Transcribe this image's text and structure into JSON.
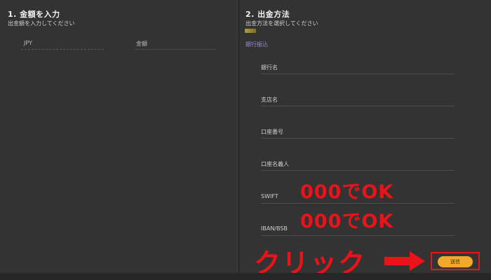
{
  "amount_section": {
    "title": "1. 金額を入力",
    "subtitle": "出金額を入力してください",
    "currency_label": "JPY",
    "amount_label": "金額"
  },
  "method_section": {
    "title": "2. 出金方法",
    "subtitle": "出金方法を選択してください",
    "selected_method": "銀行振込",
    "fields": [
      {
        "label": "銀行名"
      },
      {
        "label": "支店名"
      },
      {
        "label": "口座番号"
      },
      {
        "label": "口座名義人"
      },
      {
        "label": "SWIFT"
      },
      {
        "label": "IBAN/BSB"
      }
    ],
    "submit_label": "送信"
  },
  "annotations": {
    "swift_note": "000でOK",
    "iban_note": "000でOK",
    "click_note": "クリック"
  },
  "colors": {
    "background": "#333333",
    "accent_button": "#f0a92a",
    "annotation_red": "#e8141a"
  }
}
